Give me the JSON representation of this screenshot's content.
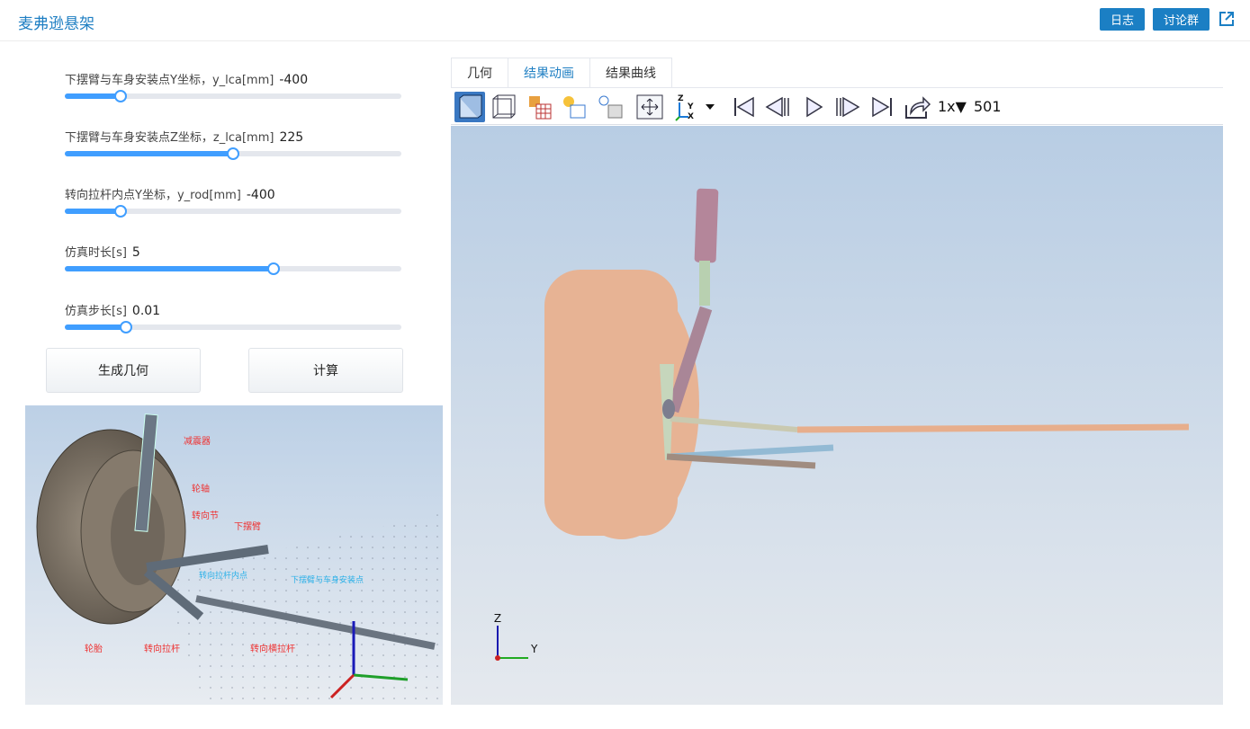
{
  "header": {
    "title": "麦弗逊悬架",
    "log_button": "日志",
    "discuss_button": "讨论群",
    "external_icon": "external-link-icon"
  },
  "params": [
    {
      "label": "下摆臂与车身安装点Y坐标，y_lca[mm]",
      "value": "-400",
      "fraction": 0.165
    },
    {
      "label": "下摆臂与车身安装点Z坐标，z_lca[mm]",
      "value": "225",
      "fraction": 0.5
    },
    {
      "label": "转向拉杆内点Y坐标，y_rod[mm]",
      "value": "-400",
      "fraction": 0.165
    },
    {
      "label": "仿真时长[s]",
      "value": "5",
      "fraction": 0.62
    },
    {
      "label": "仿真步长[s]",
      "value": "0.01",
      "fraction": 0.183
    }
  ],
  "buttons": {
    "generate": "生成几何",
    "compute": "计算"
  },
  "schematic_labels": {
    "shock": "减震器",
    "hub": "轮轴",
    "knuckle": "转向节",
    "lower_arm": "下摆臂",
    "tie_rod_inner": "转向拉杆内点",
    "lca_mount": "下摆臂与车身安装点",
    "tire": "轮胎",
    "tie_rod": "转向拉杆",
    "steering_rod": "转向横拉杆"
  },
  "tabs": [
    {
      "label": "几何",
      "active": false
    },
    {
      "label": "结果动画",
      "active": true
    },
    {
      "label": "结果曲线",
      "active": false
    }
  ],
  "toolbar": {
    "icons": [
      "solid-view-icon",
      "wireframe-view-icon",
      "grid-view-icon",
      "light-box-icon",
      "light-cube-icon",
      "fit-view-icon",
      "axis-orientation-icon",
      "skip-first-icon",
      "step-back-icon",
      "play-icon",
      "step-forward-icon",
      "skip-last-icon",
      "export-icon"
    ],
    "speed": "1x▼",
    "frame": "501"
  },
  "viewport": {
    "axis_z": "Z",
    "axis_y": "Y"
  },
  "colors": {
    "accent": "#1b7fc4",
    "slider": "#409eff"
  }
}
